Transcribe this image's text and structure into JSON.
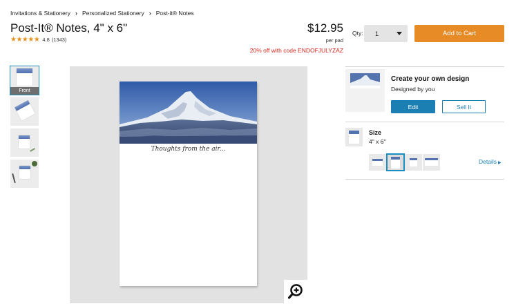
{
  "breadcrumb": [
    {
      "label": "Invitations & Stationery"
    },
    {
      "label": "Personalized Stationery"
    },
    {
      "label": "Post-it® Notes"
    }
  ],
  "product": {
    "title": "Post-It® Notes, 4\" x 6\"",
    "stars": "★★★★★",
    "rating": "4.8",
    "reviews": "(1343)",
    "price": "$12.95",
    "per_unit": "per pad",
    "promo": "20% off with code ENDOFJULYZAZ",
    "image_caption": "Thoughts from the air..."
  },
  "purchase": {
    "qty_label": "Qty:",
    "qty_value": "1",
    "add_to_cart": "Add to Cart"
  },
  "thumbnails": [
    {
      "label": "Front",
      "active": true
    },
    {
      "label": "",
      "active": false
    },
    {
      "label": "",
      "active": false
    },
    {
      "label": "",
      "active": false
    }
  ],
  "design": {
    "title": "Create your own design",
    "subtitle": "Designed by you",
    "edit_label": "Edit",
    "sell_label": "Sell It"
  },
  "size": {
    "label": "Size",
    "value": "4\" x 6\"",
    "details_label": "Details",
    "selected_option": 2,
    "option_count": 4
  },
  "colors": {
    "accent_orange": "#e78b27",
    "accent_blue": "#1c7fb3",
    "promo_red": "#d0261c",
    "star": "#e88f1c"
  }
}
